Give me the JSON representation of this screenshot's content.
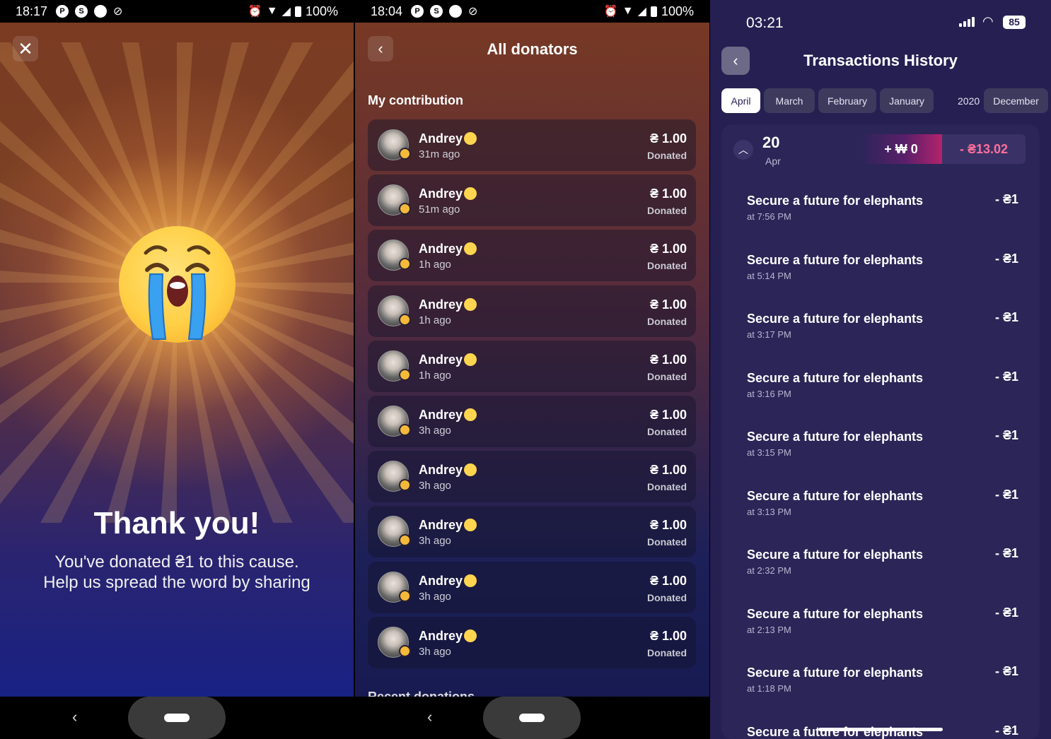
{
  "panel1": {
    "statusbar": {
      "time": "18:17",
      "battery": "100%"
    },
    "thanks_title": "Thank you!",
    "thanks_line1": "You've donated ₴1 to this cause.",
    "thanks_line2": "Help us spread the word by sharing",
    "emoji_icon": "crying-face-icon"
  },
  "panel2": {
    "statusbar": {
      "time": "18:04",
      "battery": "100%"
    },
    "title": "All donators",
    "section_title": "My contribution",
    "next_section_partial": "Recent donations",
    "donors": [
      {
        "name": "Andrey",
        "time": "31m ago",
        "amount": "₴ 1.00",
        "status": "Donated"
      },
      {
        "name": "Andrey",
        "time": "51m ago",
        "amount": "₴ 1.00",
        "status": "Donated"
      },
      {
        "name": "Andrey",
        "time": "1h ago",
        "amount": "₴ 1.00",
        "status": "Donated"
      },
      {
        "name": "Andrey",
        "time": "1h ago",
        "amount": "₴ 1.00",
        "status": "Donated"
      },
      {
        "name": "Andrey",
        "time": "1h ago",
        "amount": "₴ 1.00",
        "status": "Donated"
      },
      {
        "name": "Andrey",
        "time": "3h ago",
        "amount": "₴ 1.00",
        "status": "Donated"
      },
      {
        "name": "Andrey",
        "time": "3h ago",
        "amount": "₴ 1.00",
        "status": "Donated"
      },
      {
        "name": "Andrey",
        "time": "3h ago",
        "amount": "₴ 1.00",
        "status": "Donated"
      },
      {
        "name": "Andrey",
        "time": "3h ago",
        "amount": "₴ 1.00",
        "status": "Donated"
      },
      {
        "name": "Andrey",
        "time": "3h ago",
        "amount": "₴ 1.00",
        "status": "Donated"
      }
    ]
  },
  "panel3": {
    "status": {
      "time": "03:21",
      "battery": "85"
    },
    "title": "Transactions History",
    "months": [
      "April",
      "March",
      "February",
      "January"
    ],
    "active_month": "April",
    "year": "2020",
    "year_month": "December",
    "day": {
      "num": "20",
      "month": "Apr",
      "plus": "+ ₩ 0",
      "minus": "- ₴13.02"
    },
    "transactions": [
      {
        "title": "Secure a future for elephants",
        "time": "at 7:56 PM",
        "amount": "- ₴1"
      },
      {
        "title": "Secure a future for elephants",
        "time": "at 5:14 PM",
        "amount": "- ₴1"
      },
      {
        "title": "Secure a future for elephants",
        "time": "at 3:17 PM",
        "amount": "- ₴1"
      },
      {
        "title": "Secure a future for elephants",
        "time": "at 3:16 PM",
        "amount": "- ₴1"
      },
      {
        "title": "Secure a future for elephants",
        "time": "at 3:15 PM",
        "amount": "- ₴1"
      },
      {
        "title": "Secure a future for elephants",
        "time": "at 3:13 PM",
        "amount": "- ₴1"
      },
      {
        "title": "Secure a future for elephants",
        "time": "at 2:32 PM",
        "amount": "- ₴1"
      },
      {
        "title": "Secure a future for elephants",
        "time": "at 2:13 PM",
        "amount": "- ₴1"
      },
      {
        "title": "Secure a future for elephants",
        "time": "at 1:18 PM",
        "amount": "- ₴1"
      },
      {
        "title": "Secure a future for elephants",
        "time": "",
        "amount": "- ₴1"
      }
    ]
  },
  "colors": {
    "minus_accent": "#ff6f9b",
    "dark_bg": "#261f52",
    "active_tab": "#ffffff"
  }
}
